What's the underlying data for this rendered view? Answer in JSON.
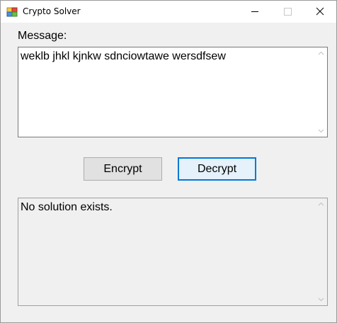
{
  "window": {
    "title": "Crypto Solver",
    "controls": [
      "minimize-icon",
      "maximize-icon",
      "close-icon"
    ]
  },
  "message": {
    "label": "Message:",
    "value": "weklb jhkl kjnkw sdnciowtawe wersdfsew"
  },
  "buttons": {
    "encrypt_label": "Encrypt",
    "decrypt_label": "Decrypt"
  },
  "output": {
    "value": "No solution exists."
  },
  "colors": {
    "focus_border": "#0078d7",
    "window_bg": "#f0f0f0"
  }
}
